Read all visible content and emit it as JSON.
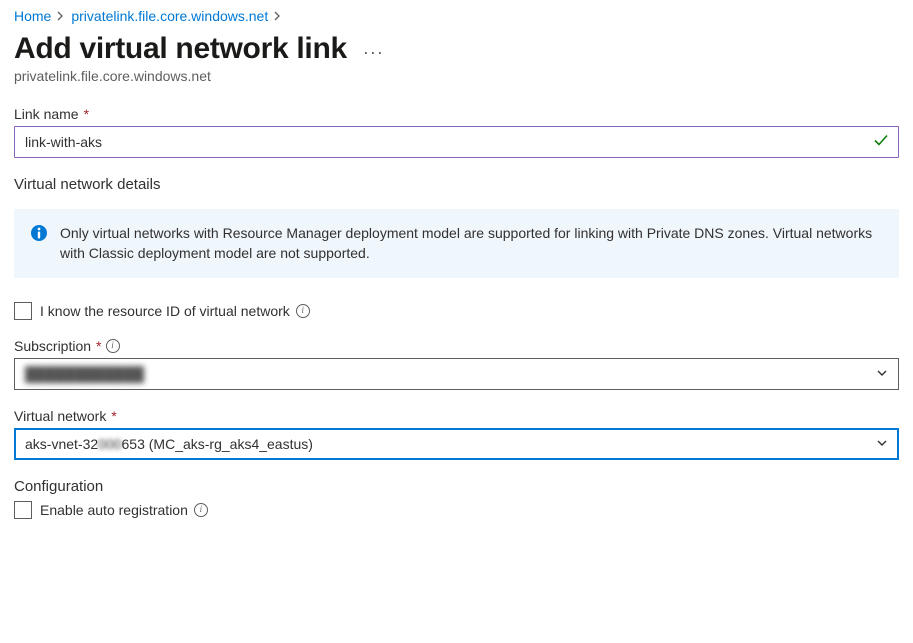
{
  "breadcrumbs": {
    "home": "Home",
    "zone": "privatelink.file.core.windows.net"
  },
  "page": {
    "title": "Add virtual network link",
    "subtitle": "privatelink.file.core.windows.net"
  },
  "fields": {
    "link_name": {
      "label": "Link name",
      "value": "link-with-aks"
    },
    "vnet_details_heading": "Virtual network details",
    "info_banner": "Only virtual networks with Resource Manager deployment model are supported for linking with Private DNS zones. Virtual networks with Classic deployment model are not supported.",
    "know_resource_id": {
      "label": "I know the resource ID of virtual network",
      "checked": false
    },
    "subscription": {
      "label": "Subscription",
      "value": "████████████"
    },
    "virtual_network": {
      "label": "Virtual network",
      "value_prefix": "aks-vnet-32",
      "value_obf": "000",
      "value_suffix": "653 (MC_aks-rg_aks4_eastus)"
    },
    "configuration": {
      "heading": "Configuration",
      "enable_auto_reg": {
        "label": "Enable auto registration",
        "checked": false
      }
    }
  }
}
